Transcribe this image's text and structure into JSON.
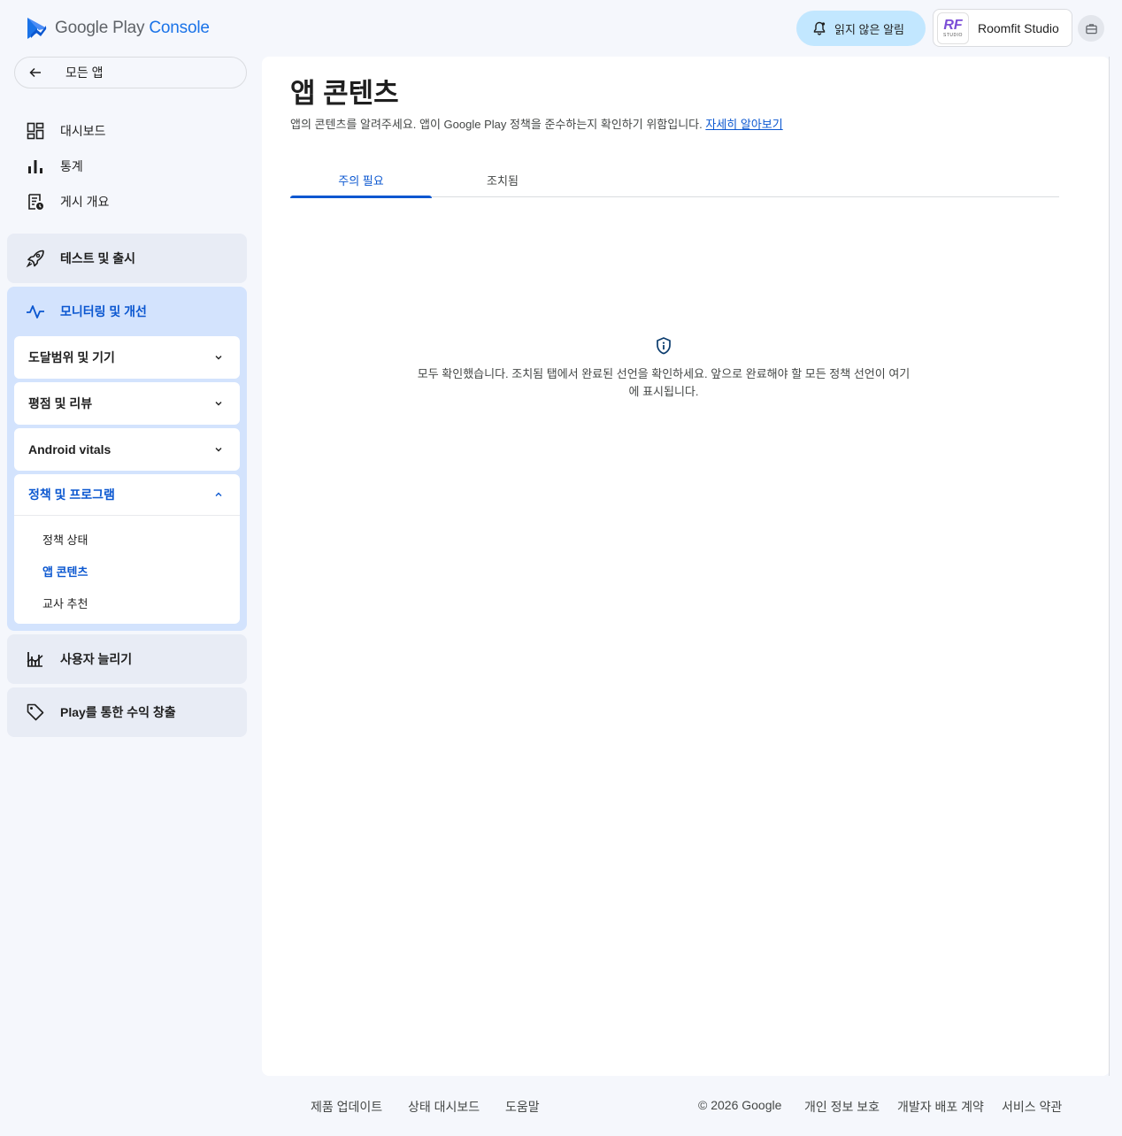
{
  "header": {
    "logo_google_play": "Google Play",
    "logo_console": "Console",
    "notifications_label": "읽지 않은 알림",
    "account_name": "Roomfit Studio",
    "account_logo_text": "RF",
    "account_logo_sub": "STUDIO"
  },
  "sidebar": {
    "back_label": "모든 앱",
    "items": [
      {
        "label": "대시보드",
        "icon": "dashboard-icon"
      },
      {
        "label": "통계",
        "icon": "bar-chart-icon"
      },
      {
        "label": "게시 개요",
        "icon": "publishing-overview-icon"
      }
    ],
    "sections": {
      "test_release": "테스트 및 출시",
      "monitor": "모니터링 및 개선",
      "grow_users": "사용자 늘리기",
      "monetize": "Play를 통한 수익 창출"
    },
    "monitor_groups": [
      "도달범위 및 기기",
      "평점 및 리뷰",
      "Android vitals",
      "정책 및 프로그램"
    ],
    "policy_links": [
      "정책 상태",
      "앱 콘텐츠",
      "교사 추천"
    ]
  },
  "main": {
    "title": "앱 콘텐츠",
    "description": "앱의 콘텐츠를 알려주세요. 앱이 Google Play 정책을 준수하는지 확인하기 위함입니다.",
    "learn_more": "자세히 알아보기",
    "tabs": [
      "주의 필요",
      "조치됨"
    ],
    "empty_message": "모두 확인했습니다. 조치됨 탭에서 완료된 선언을 확인하세요. 앞으로 완료해야 할 모든 정책 선언이 여기에 표시됩니다."
  },
  "footer": {
    "links_left": [
      "제품 업데이트",
      "상태 대시보드",
      "도움말"
    ],
    "copyright": "© 2026 Google",
    "links_right": [
      "개인 정보 보호",
      "개발자 배포 계약",
      "서비스 약관"
    ]
  },
  "colors": {
    "accent": "#0b57d0",
    "notification_bg": "#c2e7ff",
    "active_section_bg": "#d3e3fd",
    "section_bg": "#e8ecf5",
    "page_bg": "#f5f7fc"
  }
}
